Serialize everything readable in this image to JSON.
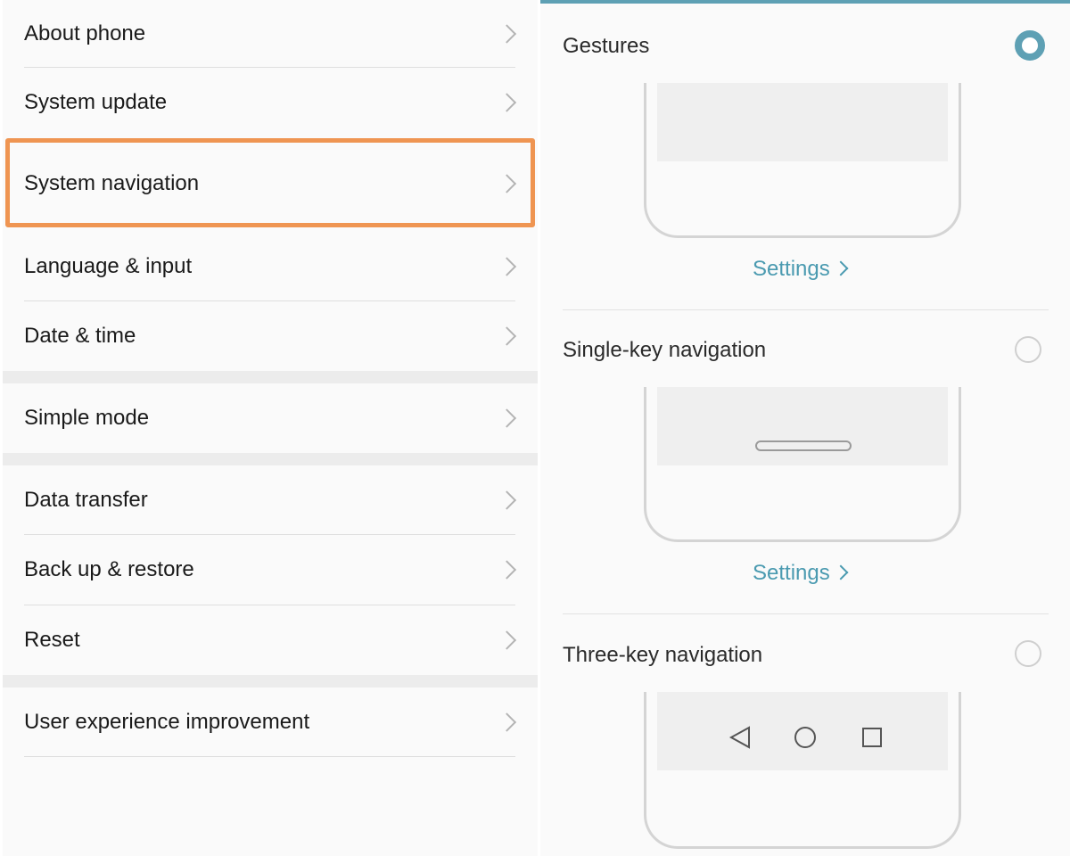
{
  "settings_list": {
    "items": [
      {
        "label": "About phone"
      },
      {
        "label": "System update"
      },
      {
        "label": "System navigation",
        "highlighted": true
      },
      {
        "label": "Language & input"
      },
      {
        "label": "Date & time"
      },
      {
        "label": "Simple mode"
      },
      {
        "label": "Data transfer"
      },
      {
        "label": "Back up & restore"
      },
      {
        "label": "Reset"
      },
      {
        "label": "User experience improvement"
      }
    ],
    "chevron_icon": "chevron-right-icon",
    "highlight_color": "#ef9552"
  },
  "navigation_panel": {
    "options": [
      {
        "label": "Gestures",
        "selected": true,
        "settings_label": "Settings"
      },
      {
        "label": "Single-key navigation",
        "selected": false,
        "settings_label": "Settings"
      },
      {
        "label": "Three-key navigation",
        "selected": false
      }
    ],
    "accent_color": "#5ea0b4",
    "nav_icons": [
      "back-triangle-icon",
      "home-circle-icon",
      "recents-square-icon"
    ]
  }
}
